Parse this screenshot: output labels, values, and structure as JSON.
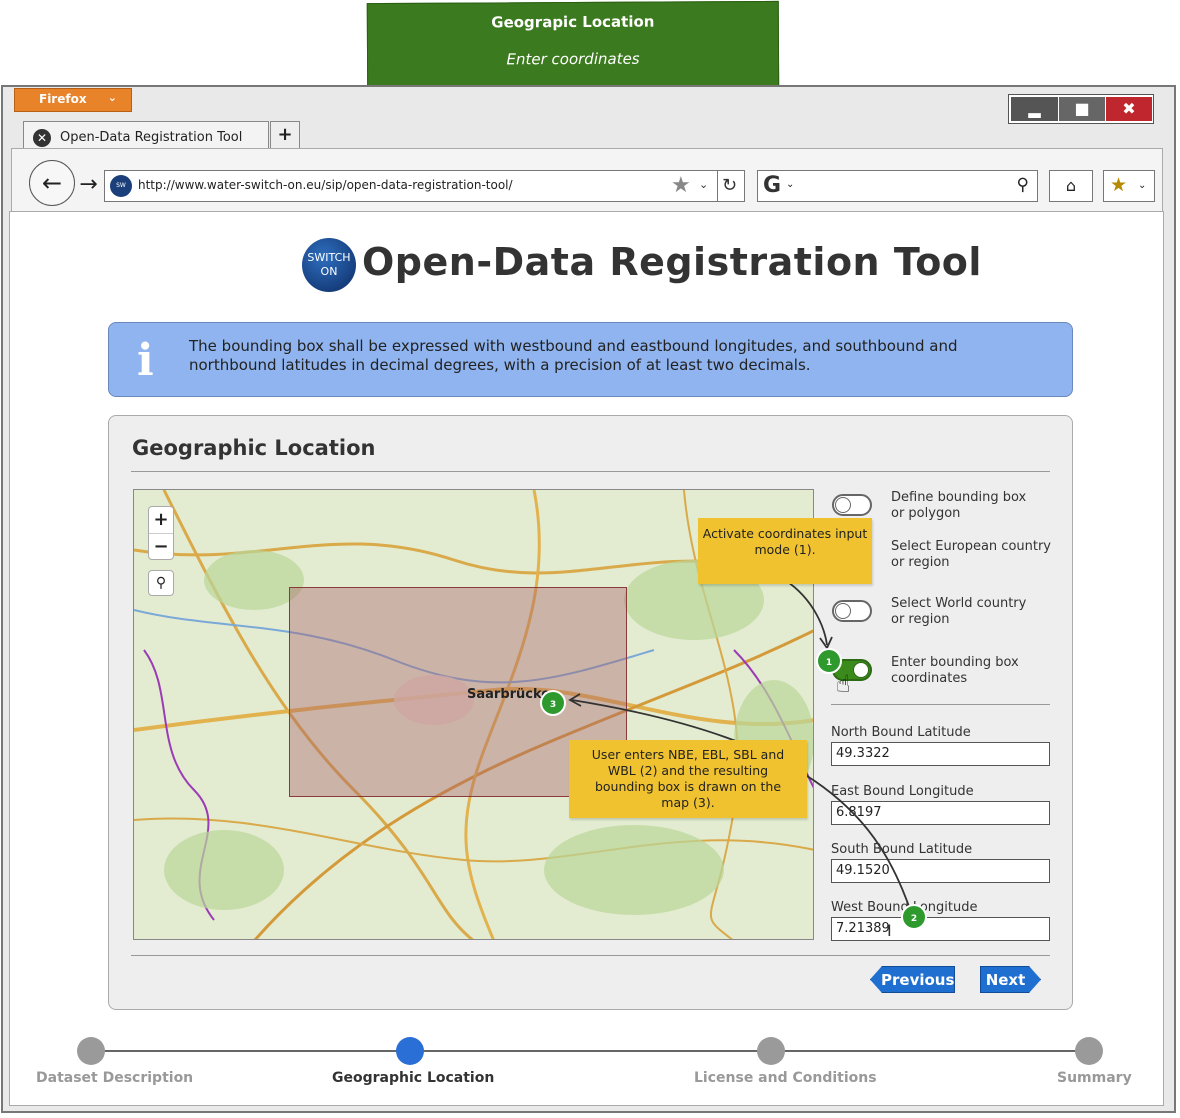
{
  "banner": {
    "title": "Geograpic Location",
    "subtitle": "Enter coordinates"
  },
  "browser": {
    "menu_button": "Firefox",
    "tab_title": "Open-Data Registration Tool",
    "url": "http://www.water-switch-on.eu/sip/open-data-registration-tool/",
    "window_controls": [
      "minimize",
      "maximize",
      "close"
    ]
  },
  "app": {
    "logo_text": "SWITCH ON",
    "title": "Open-Data Registration Tool",
    "info_text": "The bounding box shall be expressed with westbound and eastbound longitudes, and southbound and northbound latitudes in decimal degrees, with a precision of at least two decimals."
  },
  "panel": {
    "title": "Geographic Location",
    "map_city_label": "Saarbrücken",
    "options": [
      {
        "label": "Define bounding box or polygon",
        "on": false
      },
      {
        "label": "Select European country or region",
        "on": false
      },
      {
        "label": "Select World country or region",
        "on": false
      },
      {
        "label": "Enter bounding box coordinates",
        "on": true
      }
    ],
    "fields": [
      {
        "label": "North Bound Latitude",
        "value": "49.3322"
      },
      {
        "label": "East Bound Longitude",
        "value": "6.8197"
      },
      {
        "label": "South Bound Latitude",
        "value": "49.1520"
      },
      {
        "label": "West Bound Longitude",
        "value": "7.21389"
      }
    ],
    "previous_label": "Previous",
    "next_label": "Next"
  },
  "annotations": {
    "note1": "Activate coordinates input mode (1).",
    "note2": "User enters NBE, EBL, SBL and WBL (2) and the resulting bounding box is drawn on the map (3).",
    "marker1": "1",
    "marker2": "2",
    "marker3": "3"
  },
  "steps": [
    {
      "label": "Dataset Description",
      "active": false
    },
    {
      "label": "Geographic Location",
      "active": true
    },
    {
      "label": "License and Conditions",
      "active": false
    },
    {
      "label": "Summary",
      "active": false
    }
  ],
  "colors": {
    "banner": "#3b7a1e",
    "info_bg": "#8fb4ef",
    "accent_button": "#1f6fd1",
    "note": "#f0c230",
    "active_step": "#2a6fd6"
  }
}
